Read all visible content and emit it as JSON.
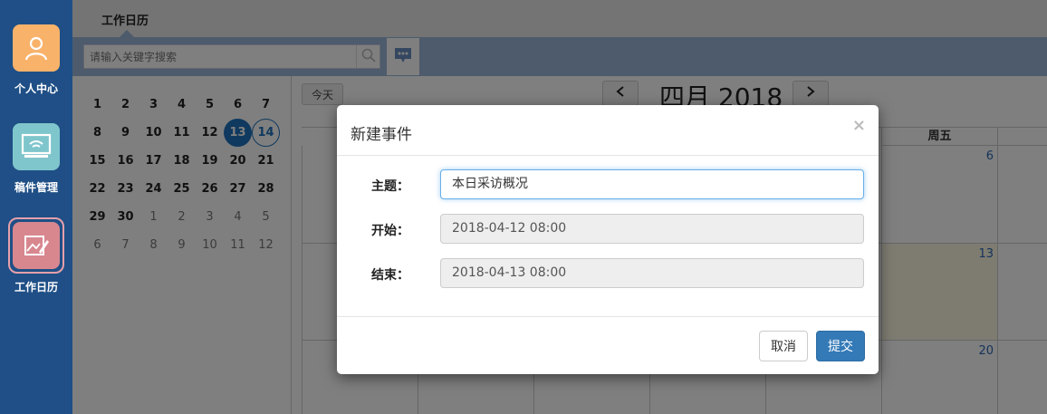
{
  "sidebar": {
    "items": [
      {
        "label": "个人中心",
        "icon": "user-icon",
        "color": "#f9b26a"
      },
      {
        "label": "稿件管理",
        "icon": "monitor-icon",
        "color": "#7fc6cc"
      },
      {
        "label": "工作日历",
        "icon": "edit-image-icon",
        "color": "#d8878f"
      }
    ]
  },
  "topbar": {
    "tab_label": "工作日历"
  },
  "search": {
    "placeholder": "请输入关键字搜索"
  },
  "calendar": {
    "today_label": "今天",
    "month_title": "四月 2018",
    "header_label": "周五",
    "mini_rows": [
      [
        {
          "d": "1"
        },
        {
          "d": "2"
        },
        {
          "d": "3"
        },
        {
          "d": "4"
        },
        {
          "d": "5"
        },
        {
          "d": "6"
        },
        {
          "d": "7"
        }
      ],
      [
        {
          "d": "8"
        },
        {
          "d": "9"
        },
        {
          "d": "10"
        },
        {
          "d": "11"
        },
        {
          "d": "12"
        },
        {
          "d": "13",
          "s": "sel"
        },
        {
          "d": "14",
          "s": "today"
        }
      ],
      [
        {
          "d": "15"
        },
        {
          "d": "16"
        },
        {
          "d": "17"
        },
        {
          "d": "18"
        },
        {
          "d": "19"
        },
        {
          "d": "20"
        },
        {
          "d": "21"
        }
      ],
      [
        {
          "d": "22"
        },
        {
          "d": "23"
        },
        {
          "d": "24"
        },
        {
          "d": "25"
        },
        {
          "d": "26"
        },
        {
          "d": "27"
        },
        {
          "d": "28"
        }
      ],
      [
        {
          "d": "29"
        },
        {
          "d": "30"
        },
        {
          "d": "1",
          "s": "other"
        },
        {
          "d": "2",
          "s": "other"
        },
        {
          "d": "3",
          "s": "other"
        },
        {
          "d": "4",
          "s": "other"
        },
        {
          "d": "5",
          "s": "other"
        }
      ],
      [
        {
          "d": "6",
          "s": "other"
        },
        {
          "d": "7",
          "s": "other"
        },
        {
          "d": "8",
          "s": "other"
        },
        {
          "d": "9",
          "s": "other"
        },
        {
          "d": "10",
          "s": "other"
        },
        {
          "d": "11",
          "s": "other"
        },
        {
          "d": "12",
          "s": "other"
        }
      ]
    ],
    "fri_days": [
      "6",
      "13",
      "20"
    ]
  },
  "modal": {
    "title": "新建事件",
    "close": "×",
    "subject_label": "主题：",
    "subject_value": "本日采访概况",
    "start_label": "开始：",
    "start_value": "2018-04-12 08:00",
    "end_label": "结束：",
    "end_value": "2018-04-13 08:00",
    "cancel_label": "取消",
    "submit_label": "提交"
  }
}
